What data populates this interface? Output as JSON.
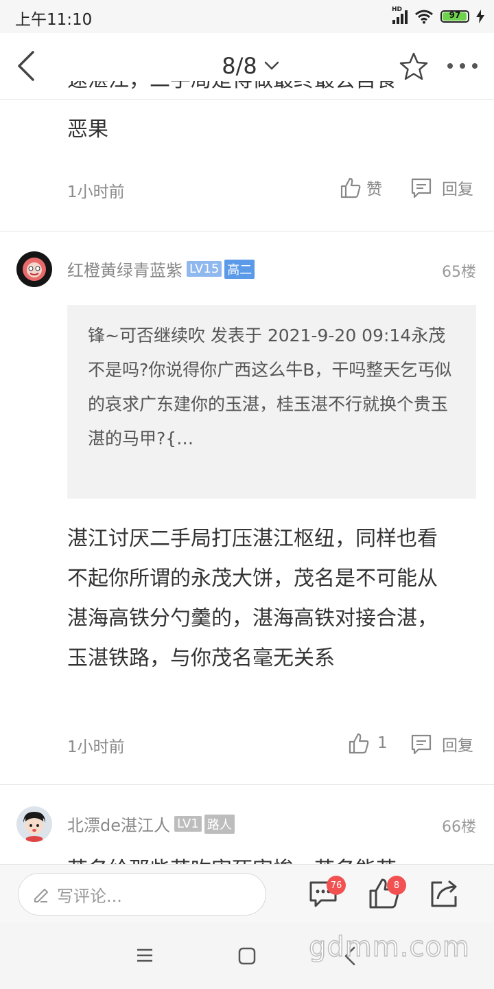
{
  "status_bar": {
    "time": "上午11:10",
    "network": "HD",
    "battery": "97",
    "battery_level": 0.97,
    "battery_color": "#6fd24f"
  },
  "header": {
    "page_indicator": "8/8",
    "icons": [
      "back-arrow-icon",
      "chevron-down-icon",
      "star-icon",
      "more-icon"
    ]
  },
  "prev_comment": {
    "partial_line": "速湛江，二手局是得做最终最会自食",
    "last_line": "恶果",
    "time": "1小时前",
    "like_label": "赞",
    "reply_label": "回复"
  },
  "comment_65": {
    "username": "红橙黄绿青蓝紫",
    "level": "LV15",
    "grade": "高二",
    "level_color": "#8fb8ee",
    "grade_color": "#5b9ae8",
    "floor": "65楼",
    "quote": "锋~可否继续吹 发表于 2021-9-20 09:14永茂不是吗?你说得你广西这么牛B，干吗整天乞丐似的哀求广东建你的玉湛，桂玉湛不行就换个贵玉湛的马甲?{…",
    "body": "湛江讨厌二手局打压湛江枢纽，同样也看不起你所谓的永茂大饼，茂名是不可能从湛海高铁分勺羹的，湛海高铁对接合湛，玉湛铁路，与你茂名毫无关系",
    "time": "1小时前",
    "like_count": "1",
    "reply_label": "回复"
  },
  "comment_66": {
    "username": "北漂de湛江人",
    "level": "LV1",
    "grade": "路人",
    "badge_color": "#bdbdbd",
    "floor": "66楼",
    "partial_text": "茂名给那些茂吹害死害惨，茂名能茂"
  },
  "bottom_bar": {
    "comment_placeholder": "写评论...",
    "comment_count": "76",
    "like_count": "8",
    "accent_color": "#f25151"
  },
  "watermark": "gdmm.com"
}
